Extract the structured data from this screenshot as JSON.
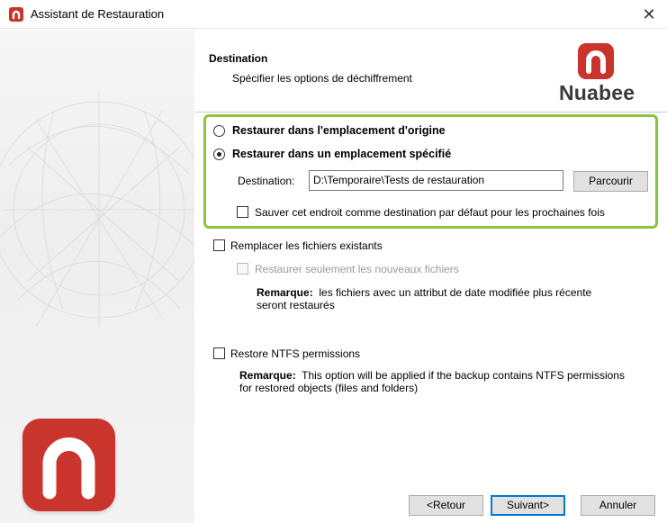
{
  "window": {
    "title": "Assistant de Restauration",
    "close_glyph": "✕"
  },
  "header": {
    "title": "Destination",
    "subtitle": "Spécifier les options de déchiffrement"
  },
  "brand": {
    "name": "Nuabee",
    "color": "#c9342c",
    "icon": "nuabee-logo-icon"
  },
  "highlight_color": "#8bc53f",
  "options": {
    "restore_original": {
      "label": "Restaurer dans l'emplacement d'origine",
      "selected": false
    },
    "restore_specified": {
      "label": "Restaurer dans un emplacement spécifié",
      "selected": true
    },
    "destination_label": "Destination:",
    "destination_value": "D:\\Temporaire\\Tests de restauration",
    "browse_label": "Parcourir",
    "save_default": {
      "label": "Sauver cet endroit comme destination par défaut pour les prochaines fois",
      "checked": false
    },
    "replace_existing": {
      "label": "Remplacer les fichiers existants",
      "checked": false
    },
    "only_newer": {
      "label": "Restaurer seulement les nouveaux fichiers",
      "checked": false,
      "disabled": true
    },
    "remark1": {
      "title": "Remarque:",
      "line1": "les fichiers avec un attribut de date modifiée plus récente",
      "line2": "seront restaurés"
    },
    "ntfs": {
      "label": "Restore NTFS permissions",
      "checked": false
    },
    "remark2": {
      "title": "Remarque:",
      "line1": "This option will be applied if the backup contains NTFS permissions",
      "line2": "for restored objects (files and folders)"
    }
  },
  "footer": {
    "back_label": "<Retour",
    "next_label": "Suivant>",
    "cancel_label": "Annuler"
  }
}
